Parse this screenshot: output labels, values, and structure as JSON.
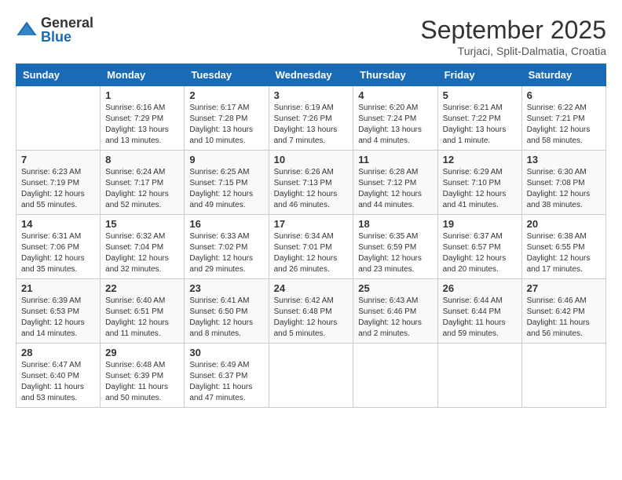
{
  "logo": {
    "text_general": "General",
    "text_blue": "Blue"
  },
  "title": "September 2025",
  "location": "Turjaci, Split-Dalmatia, Croatia",
  "days_of_week": [
    "Sunday",
    "Monday",
    "Tuesday",
    "Wednesday",
    "Thursday",
    "Friday",
    "Saturday"
  ],
  "weeks": [
    [
      {
        "day": "",
        "info": ""
      },
      {
        "day": "1",
        "info": "Sunrise: 6:16 AM\nSunset: 7:29 PM\nDaylight: 13 hours\nand 13 minutes."
      },
      {
        "day": "2",
        "info": "Sunrise: 6:17 AM\nSunset: 7:28 PM\nDaylight: 13 hours\nand 10 minutes."
      },
      {
        "day": "3",
        "info": "Sunrise: 6:19 AM\nSunset: 7:26 PM\nDaylight: 13 hours\nand 7 minutes."
      },
      {
        "day": "4",
        "info": "Sunrise: 6:20 AM\nSunset: 7:24 PM\nDaylight: 13 hours\nand 4 minutes."
      },
      {
        "day": "5",
        "info": "Sunrise: 6:21 AM\nSunset: 7:22 PM\nDaylight: 13 hours\nand 1 minute."
      },
      {
        "day": "6",
        "info": "Sunrise: 6:22 AM\nSunset: 7:21 PM\nDaylight: 12 hours\nand 58 minutes."
      }
    ],
    [
      {
        "day": "7",
        "info": "Sunrise: 6:23 AM\nSunset: 7:19 PM\nDaylight: 12 hours\nand 55 minutes."
      },
      {
        "day": "8",
        "info": "Sunrise: 6:24 AM\nSunset: 7:17 PM\nDaylight: 12 hours\nand 52 minutes."
      },
      {
        "day": "9",
        "info": "Sunrise: 6:25 AM\nSunset: 7:15 PM\nDaylight: 12 hours\nand 49 minutes."
      },
      {
        "day": "10",
        "info": "Sunrise: 6:26 AM\nSunset: 7:13 PM\nDaylight: 12 hours\nand 46 minutes."
      },
      {
        "day": "11",
        "info": "Sunrise: 6:28 AM\nSunset: 7:12 PM\nDaylight: 12 hours\nand 44 minutes."
      },
      {
        "day": "12",
        "info": "Sunrise: 6:29 AM\nSunset: 7:10 PM\nDaylight: 12 hours\nand 41 minutes."
      },
      {
        "day": "13",
        "info": "Sunrise: 6:30 AM\nSunset: 7:08 PM\nDaylight: 12 hours\nand 38 minutes."
      }
    ],
    [
      {
        "day": "14",
        "info": "Sunrise: 6:31 AM\nSunset: 7:06 PM\nDaylight: 12 hours\nand 35 minutes."
      },
      {
        "day": "15",
        "info": "Sunrise: 6:32 AM\nSunset: 7:04 PM\nDaylight: 12 hours\nand 32 minutes."
      },
      {
        "day": "16",
        "info": "Sunrise: 6:33 AM\nSunset: 7:02 PM\nDaylight: 12 hours\nand 29 minutes."
      },
      {
        "day": "17",
        "info": "Sunrise: 6:34 AM\nSunset: 7:01 PM\nDaylight: 12 hours\nand 26 minutes."
      },
      {
        "day": "18",
        "info": "Sunrise: 6:35 AM\nSunset: 6:59 PM\nDaylight: 12 hours\nand 23 minutes."
      },
      {
        "day": "19",
        "info": "Sunrise: 6:37 AM\nSunset: 6:57 PM\nDaylight: 12 hours\nand 20 minutes."
      },
      {
        "day": "20",
        "info": "Sunrise: 6:38 AM\nSunset: 6:55 PM\nDaylight: 12 hours\nand 17 minutes."
      }
    ],
    [
      {
        "day": "21",
        "info": "Sunrise: 6:39 AM\nSunset: 6:53 PM\nDaylight: 12 hours\nand 14 minutes."
      },
      {
        "day": "22",
        "info": "Sunrise: 6:40 AM\nSunset: 6:51 PM\nDaylight: 12 hours\nand 11 minutes."
      },
      {
        "day": "23",
        "info": "Sunrise: 6:41 AM\nSunset: 6:50 PM\nDaylight: 12 hours\nand 8 minutes."
      },
      {
        "day": "24",
        "info": "Sunrise: 6:42 AM\nSunset: 6:48 PM\nDaylight: 12 hours\nand 5 minutes."
      },
      {
        "day": "25",
        "info": "Sunrise: 6:43 AM\nSunset: 6:46 PM\nDaylight: 12 hours\nand 2 minutes."
      },
      {
        "day": "26",
        "info": "Sunrise: 6:44 AM\nSunset: 6:44 PM\nDaylight: 11 hours\nand 59 minutes."
      },
      {
        "day": "27",
        "info": "Sunrise: 6:46 AM\nSunset: 6:42 PM\nDaylight: 11 hours\nand 56 minutes."
      }
    ],
    [
      {
        "day": "28",
        "info": "Sunrise: 6:47 AM\nSunset: 6:40 PM\nDaylight: 11 hours\nand 53 minutes."
      },
      {
        "day": "29",
        "info": "Sunrise: 6:48 AM\nSunset: 6:39 PM\nDaylight: 11 hours\nand 50 minutes."
      },
      {
        "day": "30",
        "info": "Sunrise: 6:49 AM\nSunset: 6:37 PM\nDaylight: 11 hours\nand 47 minutes."
      },
      {
        "day": "",
        "info": ""
      },
      {
        "day": "",
        "info": ""
      },
      {
        "day": "",
        "info": ""
      },
      {
        "day": "",
        "info": ""
      }
    ]
  ]
}
